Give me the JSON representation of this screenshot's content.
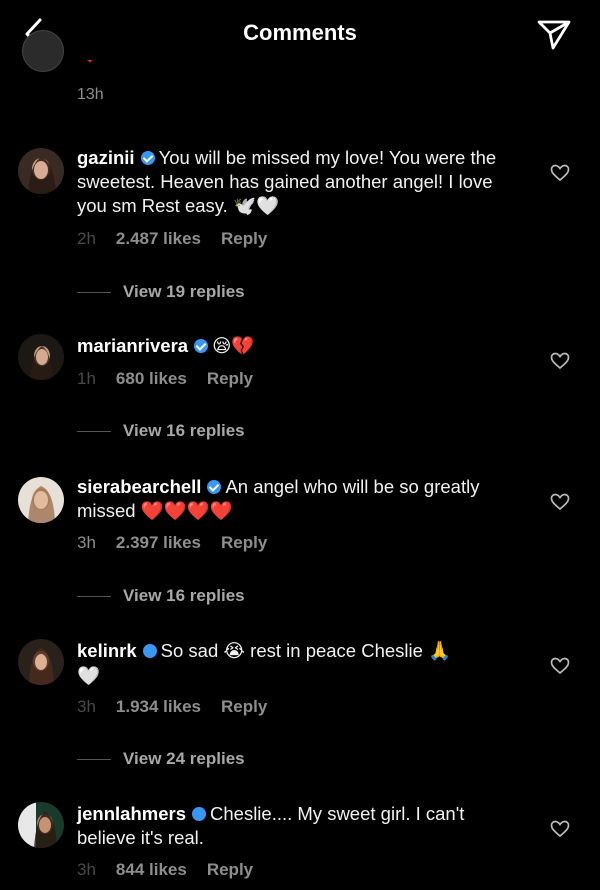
{
  "header": {
    "title": "Comments",
    "back_icon": "chevron-left-icon",
    "send_icon": "paper-plane-icon"
  },
  "partial_comment": {
    "time": "13h"
  },
  "comments": [
    {
      "username": "gazinii",
      "text": "You will be missed my love! You were the sweetest. Heaven has gained another angel! I love you sm Rest easy.",
      "emoji": "🕊️🤍",
      "time": "2h",
      "likes": "2.487 likes",
      "reply": "Reply",
      "view_replies": "View 19 replies"
    },
    {
      "username": "marianrivera",
      "text": "",
      "emoji": "😪💔",
      "time": "1h",
      "likes": "680 likes",
      "reply": "Reply",
      "view_replies": "View 16 replies"
    },
    {
      "username": "sierabearchell",
      "text": "An angel who will be so greatly missed",
      "emoji": "❤️❤️❤️❤️",
      "time": "3h",
      "likes": "2.397 likes",
      "reply": "Reply",
      "view_replies": "View 16 replies"
    },
    {
      "username": "kelinrk",
      "text_a": "So sad",
      "emoji_a": "😭",
      "text_b": "rest in peace Cheslie",
      "emoji_b": "🙏",
      "emoji_c": "🤍",
      "time": "3h",
      "likes": "1.934 likes",
      "reply": "Reply",
      "view_replies": "View 24 replies"
    },
    {
      "username": "jennlahmers",
      "text": "Cheslie.... My sweet girl. I can't believe it's real.",
      "time": "3h",
      "likes": "844 likes",
      "reply": "Reply"
    }
  ],
  "colors": {
    "background": "#000000",
    "secondary_text": "#8e8e8e",
    "verified": "#3897f0",
    "heart_red": "#e0243a"
  }
}
